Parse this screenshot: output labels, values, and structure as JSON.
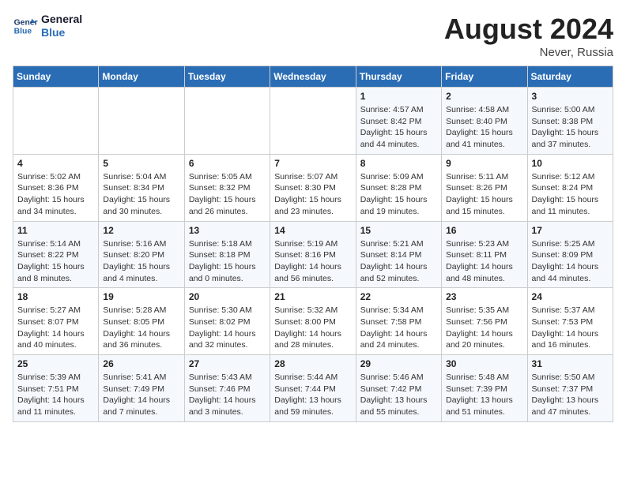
{
  "header": {
    "logo_line1": "General",
    "logo_line2": "Blue",
    "month_year": "August 2024",
    "location": "Never, Russia"
  },
  "weekdays": [
    "Sunday",
    "Monday",
    "Tuesday",
    "Wednesday",
    "Thursday",
    "Friday",
    "Saturday"
  ],
  "weeks": [
    [
      {
        "day": "",
        "info": ""
      },
      {
        "day": "",
        "info": ""
      },
      {
        "day": "",
        "info": ""
      },
      {
        "day": "",
        "info": ""
      },
      {
        "day": "1",
        "info": "Sunrise: 4:57 AM\nSunset: 8:42 PM\nDaylight: 15 hours\nand 44 minutes."
      },
      {
        "day": "2",
        "info": "Sunrise: 4:58 AM\nSunset: 8:40 PM\nDaylight: 15 hours\nand 41 minutes."
      },
      {
        "day": "3",
        "info": "Sunrise: 5:00 AM\nSunset: 8:38 PM\nDaylight: 15 hours\nand 37 minutes."
      }
    ],
    [
      {
        "day": "4",
        "info": "Sunrise: 5:02 AM\nSunset: 8:36 PM\nDaylight: 15 hours\nand 34 minutes."
      },
      {
        "day": "5",
        "info": "Sunrise: 5:04 AM\nSunset: 8:34 PM\nDaylight: 15 hours\nand 30 minutes."
      },
      {
        "day": "6",
        "info": "Sunrise: 5:05 AM\nSunset: 8:32 PM\nDaylight: 15 hours\nand 26 minutes."
      },
      {
        "day": "7",
        "info": "Sunrise: 5:07 AM\nSunset: 8:30 PM\nDaylight: 15 hours\nand 23 minutes."
      },
      {
        "day": "8",
        "info": "Sunrise: 5:09 AM\nSunset: 8:28 PM\nDaylight: 15 hours\nand 19 minutes."
      },
      {
        "day": "9",
        "info": "Sunrise: 5:11 AM\nSunset: 8:26 PM\nDaylight: 15 hours\nand 15 minutes."
      },
      {
        "day": "10",
        "info": "Sunrise: 5:12 AM\nSunset: 8:24 PM\nDaylight: 15 hours\nand 11 minutes."
      }
    ],
    [
      {
        "day": "11",
        "info": "Sunrise: 5:14 AM\nSunset: 8:22 PM\nDaylight: 15 hours\nand 8 minutes."
      },
      {
        "day": "12",
        "info": "Sunrise: 5:16 AM\nSunset: 8:20 PM\nDaylight: 15 hours\nand 4 minutes."
      },
      {
        "day": "13",
        "info": "Sunrise: 5:18 AM\nSunset: 8:18 PM\nDaylight: 15 hours\nand 0 minutes."
      },
      {
        "day": "14",
        "info": "Sunrise: 5:19 AM\nSunset: 8:16 PM\nDaylight: 14 hours\nand 56 minutes."
      },
      {
        "day": "15",
        "info": "Sunrise: 5:21 AM\nSunset: 8:14 PM\nDaylight: 14 hours\nand 52 minutes."
      },
      {
        "day": "16",
        "info": "Sunrise: 5:23 AM\nSunset: 8:11 PM\nDaylight: 14 hours\nand 48 minutes."
      },
      {
        "day": "17",
        "info": "Sunrise: 5:25 AM\nSunset: 8:09 PM\nDaylight: 14 hours\nand 44 minutes."
      }
    ],
    [
      {
        "day": "18",
        "info": "Sunrise: 5:27 AM\nSunset: 8:07 PM\nDaylight: 14 hours\nand 40 minutes."
      },
      {
        "day": "19",
        "info": "Sunrise: 5:28 AM\nSunset: 8:05 PM\nDaylight: 14 hours\nand 36 minutes."
      },
      {
        "day": "20",
        "info": "Sunrise: 5:30 AM\nSunset: 8:02 PM\nDaylight: 14 hours\nand 32 minutes."
      },
      {
        "day": "21",
        "info": "Sunrise: 5:32 AM\nSunset: 8:00 PM\nDaylight: 14 hours\nand 28 minutes."
      },
      {
        "day": "22",
        "info": "Sunrise: 5:34 AM\nSunset: 7:58 PM\nDaylight: 14 hours\nand 24 minutes."
      },
      {
        "day": "23",
        "info": "Sunrise: 5:35 AM\nSunset: 7:56 PM\nDaylight: 14 hours\nand 20 minutes."
      },
      {
        "day": "24",
        "info": "Sunrise: 5:37 AM\nSunset: 7:53 PM\nDaylight: 14 hours\nand 16 minutes."
      }
    ],
    [
      {
        "day": "25",
        "info": "Sunrise: 5:39 AM\nSunset: 7:51 PM\nDaylight: 14 hours\nand 11 minutes."
      },
      {
        "day": "26",
        "info": "Sunrise: 5:41 AM\nSunset: 7:49 PM\nDaylight: 14 hours\nand 7 minutes."
      },
      {
        "day": "27",
        "info": "Sunrise: 5:43 AM\nSunset: 7:46 PM\nDaylight: 14 hours\nand 3 minutes."
      },
      {
        "day": "28",
        "info": "Sunrise: 5:44 AM\nSunset: 7:44 PM\nDaylight: 13 hours\nand 59 minutes."
      },
      {
        "day": "29",
        "info": "Sunrise: 5:46 AM\nSunset: 7:42 PM\nDaylight: 13 hours\nand 55 minutes."
      },
      {
        "day": "30",
        "info": "Sunrise: 5:48 AM\nSunset: 7:39 PM\nDaylight: 13 hours\nand 51 minutes."
      },
      {
        "day": "31",
        "info": "Sunrise: 5:50 AM\nSunset: 7:37 PM\nDaylight: 13 hours\nand 47 minutes."
      }
    ]
  ]
}
